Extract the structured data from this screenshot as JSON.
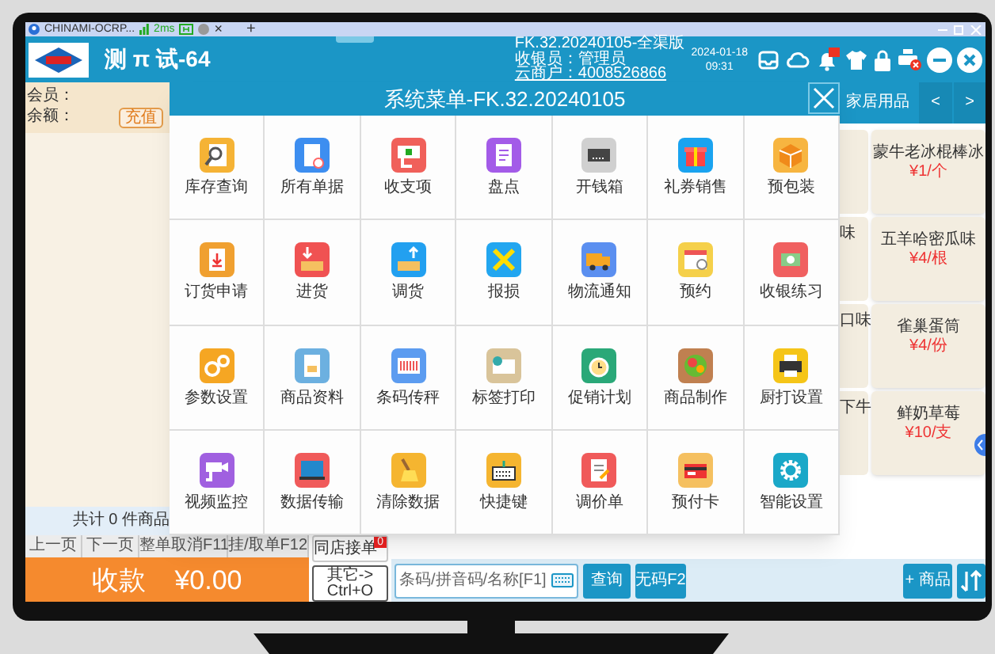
{
  "browser_tab": {
    "title": "CHINAMI-OCRP...",
    "latency": "2ms",
    "close": "×",
    "new_tab": "+"
  },
  "header": {
    "title": "测 π 试-64",
    "info": [
      "FK.32.20240105-全渠版",
      "收银员：管理员",
      "云商户：4008526866"
    ],
    "date": "2024-01-18",
    "time": "09:31"
  },
  "member_panel": {
    "member_label": "会员：",
    "balance_label": "余额：",
    "recharge_button": "充值",
    "total": "共计 0 件商品",
    "buttons": [
      "上一页",
      "下一页",
      "整单取消F11",
      "挂/取单F12"
    ],
    "checkout_label": "收款",
    "checkout_amount": "¥0.00"
  },
  "category_bar": {
    "category": "家居用品",
    "prev": "<",
    "next": ">"
  },
  "product_rows": [
    {
      "card": {
        "name": "蒙牛老冰棍棒冰",
        "price": "¥1/个"
      }
    },
    {
      "cut_card": "味",
      "card": {
        "name": "五羊哈密瓜味",
        "price": "¥4/根"
      }
    },
    {
      "cut_card": "口味",
      "card": {
        "name": "雀巢蛋筒",
        "price": "¥4/份"
      }
    },
    {
      "cut_card": "下牛",
      "card": {
        "name": "鲜奶草莓",
        "price": "¥10/支"
      }
    }
  ],
  "menu_dialog": {
    "title": "系统菜单-FK.32.20240105",
    "items": [
      {
        "label": "库存查询"
      },
      {
        "label": "所有单据"
      },
      {
        "label": "收支项"
      },
      {
        "label": "盘点"
      },
      {
        "label": "开钱箱"
      },
      {
        "label": "礼券销售"
      },
      {
        "label": "预包装"
      },
      {
        "label": "订货申请"
      },
      {
        "label": "进货"
      },
      {
        "label": "调货"
      },
      {
        "label": "报损"
      },
      {
        "label": "物流通知"
      },
      {
        "label": "预约"
      },
      {
        "label": "收银练习"
      },
      {
        "label": "参数设置"
      },
      {
        "label": "商品资料"
      },
      {
        "label": "条码传秤"
      },
      {
        "label": "标签打印"
      },
      {
        "label": "促销计划"
      },
      {
        "label": "商品制作"
      },
      {
        "label": "厨打设置"
      },
      {
        "label": "视频监控"
      },
      {
        "label": "数据传输"
      },
      {
        "label": "清除数据"
      },
      {
        "label": "快捷键"
      },
      {
        "label": "调价单"
      },
      {
        "label": "预付卡"
      },
      {
        "label": "智能设置"
      }
    ]
  },
  "bottom_bar": {
    "shop_orders": {
      "label": "同店接单",
      "badge": "0"
    },
    "other_button": "其它-> Ctrl+O",
    "search": {
      "placeholder": "条码/拼音码/名称[F1]"
    },
    "query_button": "查询",
    "no_code_button": "无码F2",
    "add_product_button": "+ 商品"
  }
}
